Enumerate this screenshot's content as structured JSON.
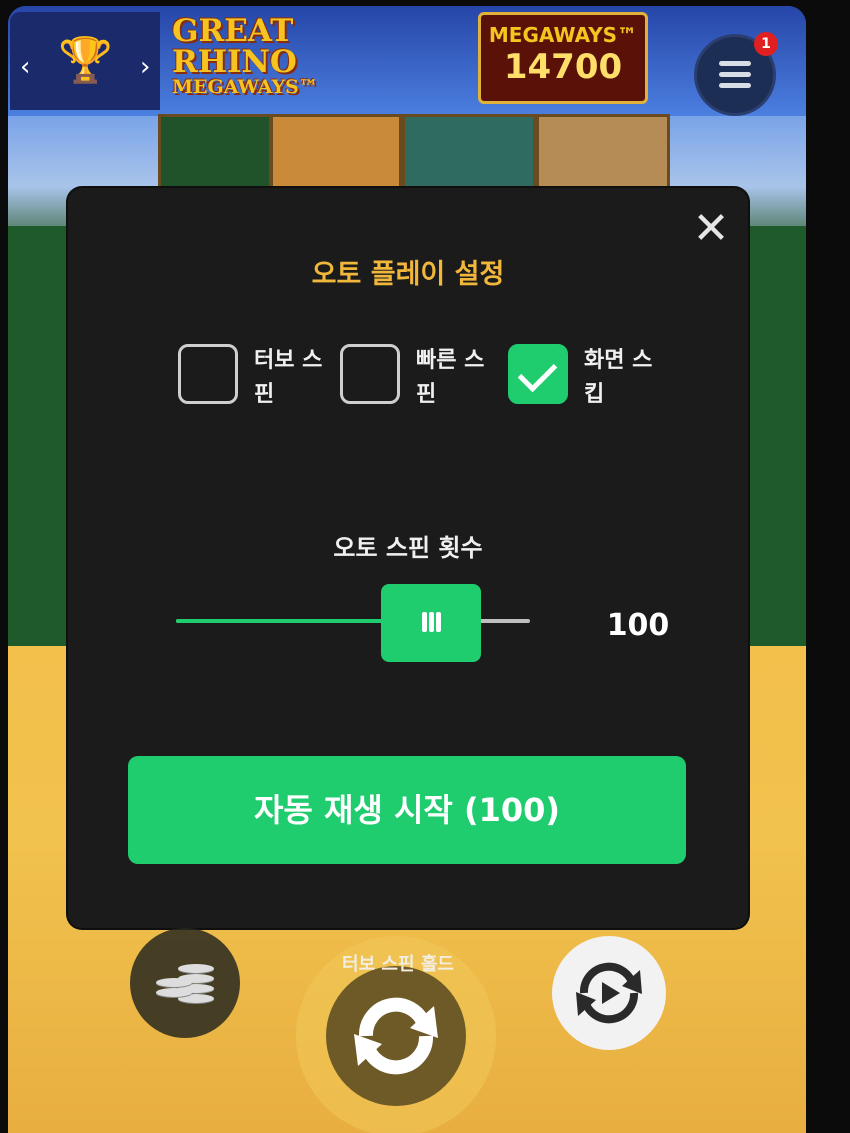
{
  "header": {
    "logo": [
      "GREAT",
      "RHINO",
      "MEGAWAYS™"
    ],
    "megaways_label": "MEGAWAYS™",
    "megaways_value": "14700",
    "menu_badge": "1"
  },
  "dialog": {
    "title": "오토 플레이 설정",
    "options": [
      {
        "label": "터보 스핀",
        "checked": false
      },
      {
        "label": "빠른 스핀",
        "checked": false
      },
      {
        "label": "화면 스킵",
        "checked": true
      }
    ],
    "spin_count_title": "오토 스핀 횟수",
    "slider_level": 0.72,
    "spin_count_value": "100",
    "start_button": "자동 재생 시작 (100)"
  },
  "controls": {
    "hold_label": "터보 스핀 홀드"
  },
  "colors": {
    "accent_green": "#1fcc6e",
    "title_gold": "#f0b73a",
    "dialog_bg": "#1b1b1b"
  },
  "icons": {
    "close": "close-icon",
    "trophy": "trophy-icon",
    "menu": "menu-icon",
    "coins": "coins-icon",
    "spin": "spin-icon",
    "autoplay": "autoplay-icon"
  }
}
